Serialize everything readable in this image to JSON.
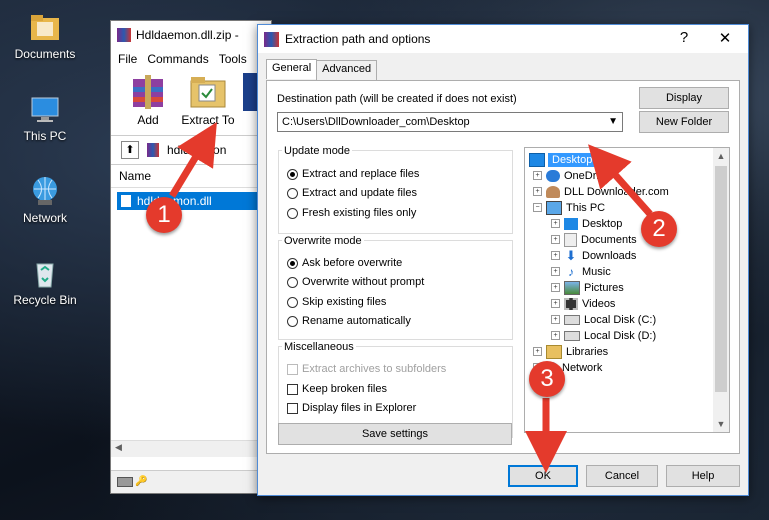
{
  "desktop": {
    "icons": [
      {
        "label": "Documents",
        "icon": "folder-icon"
      },
      {
        "label": "This PC",
        "icon": "computer-icon"
      },
      {
        "label": "Network",
        "icon": "network-globe-icon"
      },
      {
        "label": "Recycle Bin",
        "icon": "recycle-bin-icon"
      }
    ]
  },
  "archive_window": {
    "title": "Hdldaemon.dll.zip -",
    "menu": [
      "File",
      "Commands",
      "Tools"
    ],
    "toolbar": {
      "add": "Add",
      "extract_to": "Extract To"
    },
    "path": "hdldaemon",
    "column_name": "Name",
    "file": "hdldaemon.dll"
  },
  "dialog": {
    "title": "Extraction path and options",
    "help_glyph": "?",
    "close_glyph": "✕",
    "tabs": [
      "General",
      "Advanced"
    ],
    "destination_label": "Destination path (will be created if does not exist)",
    "destination_value": "C:\\Users\\DllDownloader_com\\Desktop",
    "display_button": "Display",
    "new_folder_button": "New Folder",
    "update_mode": {
      "title": "Update mode",
      "options": [
        "Extract and replace files",
        "Extract and update files",
        "Fresh existing files only"
      ],
      "selected": 0
    },
    "overwrite_mode": {
      "title": "Overwrite mode",
      "options": [
        "Ask before overwrite",
        "Overwrite without prompt",
        "Skip existing files",
        "Rename automatically"
      ],
      "selected": 0
    },
    "miscellaneous": {
      "title": "Miscellaneous",
      "options": [
        "Extract archives to subfolders",
        "Keep broken files",
        "Display files in Explorer"
      ]
    },
    "save_settings": "Save settings",
    "tree": [
      {
        "label": "Desktop",
        "icon": "desktop-icon",
        "selected": true
      },
      {
        "label": "OneDrive",
        "icon": "cloud-icon"
      },
      {
        "label": "DLL Downloader.com",
        "icon": "user-icon"
      },
      {
        "label": "This PC",
        "icon": "computer-icon"
      },
      {
        "label": "Desktop",
        "icon": "desktop-icon"
      },
      {
        "label": "Documents",
        "icon": "document-icon"
      },
      {
        "label": "Downloads",
        "icon": "download-arrow-icon"
      },
      {
        "label": "Music",
        "icon": "music-note-icon"
      },
      {
        "label": "Pictures",
        "icon": "pictures-icon"
      },
      {
        "label": "Videos",
        "icon": "film-icon"
      },
      {
        "label": "Local Disk (C:)",
        "icon": "drive-icon"
      },
      {
        "label": "Local Disk (D:)",
        "icon": "drive-icon"
      },
      {
        "label": "Libraries",
        "icon": "library-icon"
      },
      {
        "label": "Network",
        "icon": "network-icon"
      }
    ],
    "ok": "OK",
    "cancel": "Cancel",
    "help": "Help"
  },
  "annotations": {
    "callouts": [
      "1",
      "2",
      "3"
    ],
    "color": "#e43a2c"
  }
}
